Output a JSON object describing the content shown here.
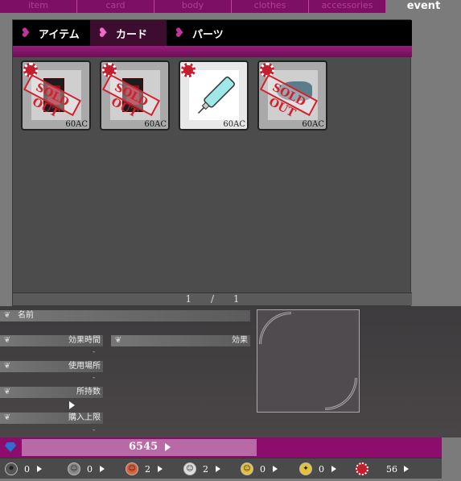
{
  "top_tabs": [
    "item",
    "card",
    "body",
    "clothes",
    "accessories",
    "event"
  ],
  "sub_tabs": [
    "アイテム",
    "カード",
    "パーツ"
  ],
  "cards": [
    {
      "price": "60AC",
      "sold_out": true,
      "stamp": "SOLD OUT"
    },
    {
      "price": "60AC",
      "sold_out": true,
      "stamp": "SOLD OUT"
    },
    {
      "price": "60AC",
      "sold_out": false
    },
    {
      "price": "60AC",
      "sold_out": true,
      "stamp": "SOLD OUT"
    }
  ],
  "pager": {
    "current": "1",
    "separator": "/",
    "total": "1"
  },
  "detail": {
    "name_label": "名前",
    "duration_label": "効果時間",
    "duration_value": "-",
    "effect_label": "効果",
    "location_label": "使用場所",
    "location_value": "-",
    "owned_label": "所持数",
    "limit_label": "購入上限",
    "limit_value": "-"
  },
  "currency": {
    "value": "6545",
    "icon": "gem-icon",
    "color": "#8c0d6c"
  },
  "stats": [
    {
      "icon": "gear-coin-icon",
      "value": "0"
    },
    {
      "icon": "gray-face-icon",
      "value": "0"
    },
    {
      "icon": "red-face-icon",
      "value": "2"
    },
    {
      "icon": "white-face-icon",
      "value": "2"
    },
    {
      "icon": "yellow-face-icon",
      "value": "0"
    },
    {
      "icon": "sparkle-face-icon",
      "value": "0"
    },
    {
      "icon": "chip-icon",
      "value": "56"
    }
  ]
}
